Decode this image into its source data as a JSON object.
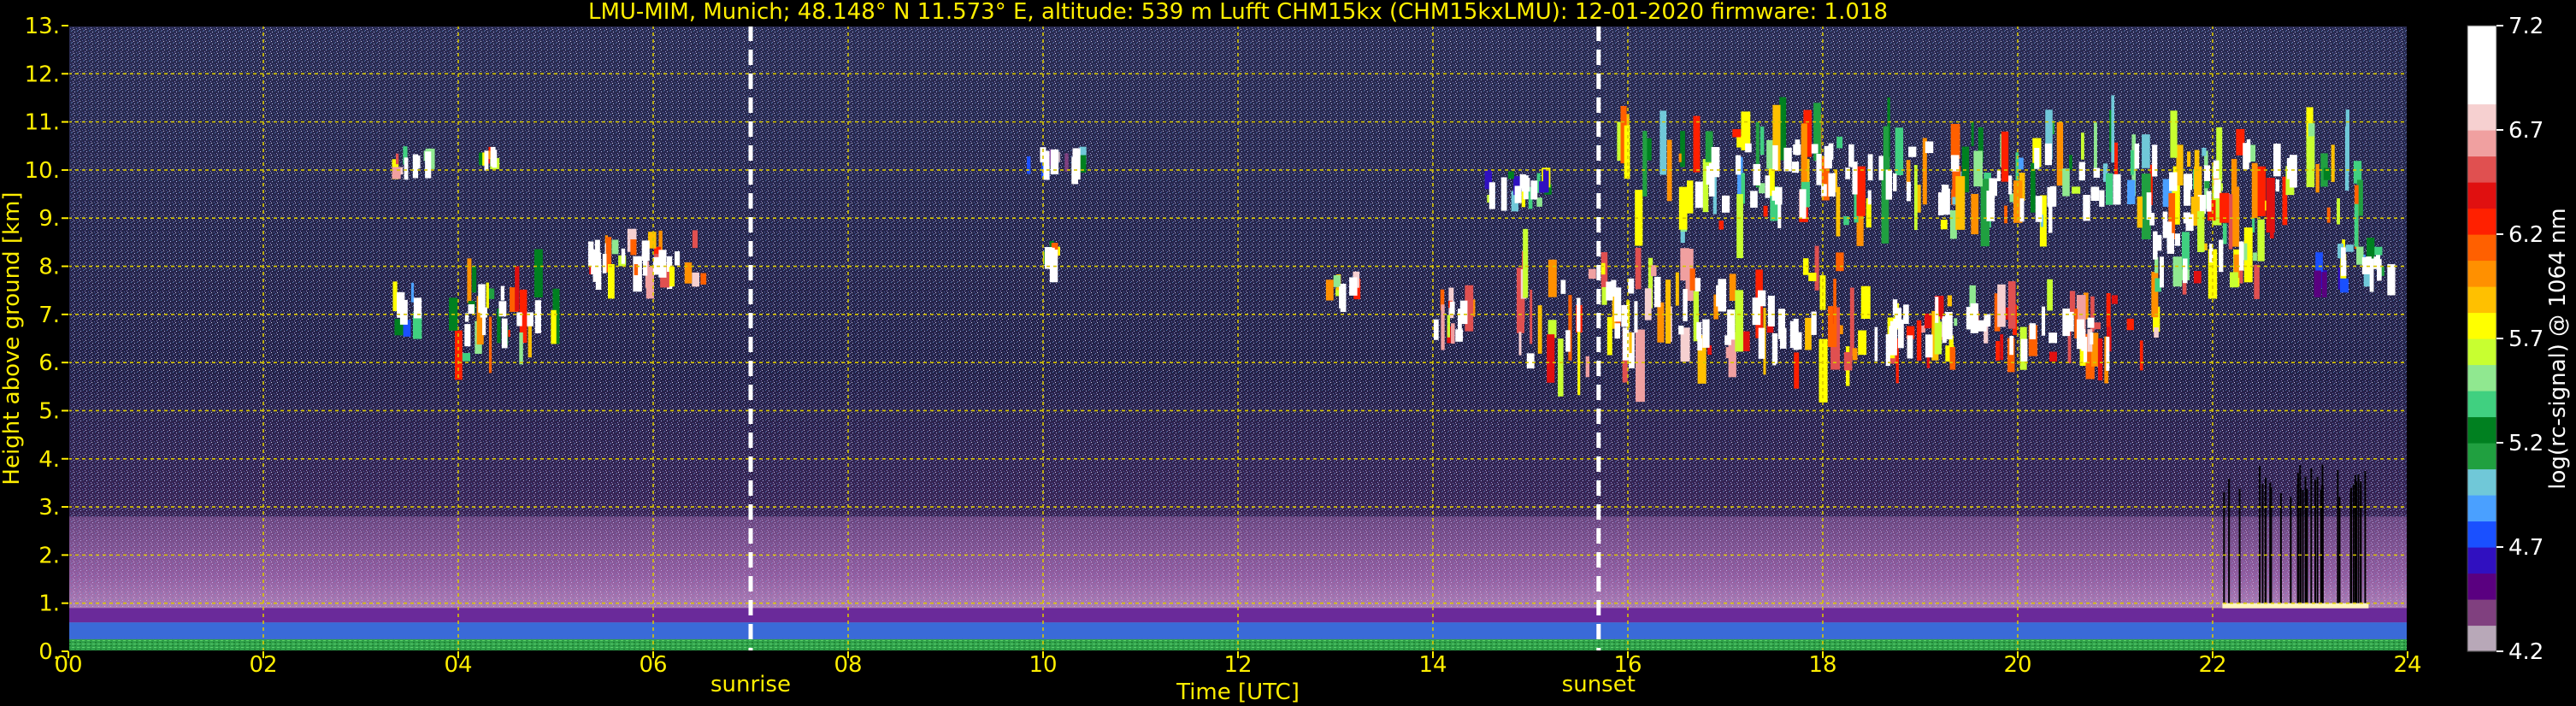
{
  "title": "LMU-MIM, Munich; 48.148° N 11.573° E, altitude: 539 m    Lufft CHM15kx (CHM15kxLMU): 12-01-2020    firmware: 1.018",
  "colors": {
    "background": "#000000",
    "axis_text": "#ffee00",
    "grid": "#d8c600",
    "markers": "#ffffff"
  },
  "chart_data": {
    "type": "heatmap",
    "title": "LMU-MIM, Munich; 48.148° N 11.573° E, altitude: 539 m    Lufft CHM15kx (CHM15kxLMU): 12-01-2020    firmware: 1.018",
    "xlabel": "Time [UTC]",
    "ylabel": "Height above ground [km]",
    "xlim": [
      0,
      24
    ],
    "ylim": [
      0,
      13
    ],
    "xticks": [
      0,
      2,
      4,
      6,
      8,
      10,
      12,
      14,
      16,
      18,
      20,
      22,
      24
    ],
    "xtick_labels": [
      "00",
      "02",
      "04",
      "06",
      "08",
      "10",
      "12",
      "14",
      "16",
      "18",
      "20",
      "22",
      "24"
    ],
    "yticks": [
      0,
      1,
      2,
      3,
      4,
      5,
      6,
      7,
      8,
      9,
      10,
      11,
      12,
      13
    ],
    "ytick_labels": [
      "0.",
      "1.",
      "2.",
      "3.",
      "4.",
      "5.",
      "6.",
      "7.",
      "8.",
      "9.",
      "10.",
      "11.",
      "12.",
      "13."
    ],
    "grid": true,
    "markers": [
      {
        "label": "sunrise",
        "x": 7.0
      },
      {
        "label": "sunset",
        "x": 15.7
      }
    ],
    "colorbar": {
      "label": "log(rc-signal) @ 1064 nm",
      "min": 4.2,
      "max": 7.2,
      "ticks": [
        4.2,
        4.7,
        5.2,
        5.7,
        6.2,
        6.7,
        7.2
      ],
      "tick_labels": [
        "4.2",
        "4.7",
        "5.2",
        "5.7",
        "6.2",
        "6.7",
        "7.2"
      ],
      "colors": [
        "#b8a8b8",
        "#80407f",
        "#5a0080",
        "#3010c0",
        "#1a50ff",
        "#4aa0ff",
        "#70c8d8",
        "#20a040",
        "#008020",
        "#40d080",
        "#90e890",
        "#c8ff30",
        "#ffff00",
        "#ffc000",
        "#ff9000",
        "#ff6000",
        "#ff2000",
        "#e01010",
        "#e05050",
        "#f0a0a0",
        "#f6d0d0",
        "#ffffff",
        "#ffffff",
        "#ffffff"
      ]
    },
    "features": [
      {
        "kind": "boundary_layer",
        "x": [
          0,
          24
        ],
        "y": [
          0,
          0.9
        ],
        "value": 5.4
      },
      {
        "kind": "residual_layer",
        "x": [
          0,
          24
        ],
        "y": [
          0.9,
          2.8
        ],
        "value": 4.6
      },
      {
        "kind": "cloud",
        "x": [
          3.3,
          3.7
        ],
        "y": [
          9.9,
          10.4
        ],
        "value": 6.8
      },
      {
        "kind": "cloud",
        "x": [
          4.2,
          4.4
        ],
        "y": [
          10.1,
          10.4
        ],
        "value": 6.6
      },
      {
        "kind": "cloud",
        "x": [
          3.3,
          3.6
        ],
        "y": [
          6.5,
          7.5
        ],
        "value": 5.8
      },
      {
        "kind": "cloud",
        "x": [
          3.9,
          5.1
        ],
        "y": [
          6.1,
          7.9
        ],
        "value": 6.5
      },
      {
        "kind": "cloud",
        "x": [
          5.2,
          6.5
        ],
        "y": [
          7.6,
          8.6
        ],
        "value": 6.9
      },
      {
        "kind": "cloud",
        "x": [
          9.8,
          10.4
        ],
        "y": [
          10.0,
          10.4
        ],
        "value": 5.4
      },
      {
        "kind": "cloud",
        "x": [
          10.0,
          10.1
        ],
        "y": [
          8.1,
          8.4
        ],
        "value": 6.6
      },
      {
        "kind": "cloud",
        "x": [
          12.9,
          13.2
        ],
        "y": [
          7.3,
          7.8
        ],
        "value": 6.8
      },
      {
        "kind": "cloud",
        "x": [
          13.9,
          14.4
        ],
        "y": [
          6.0,
          7.4
        ],
        "value": 6.8
      },
      {
        "kind": "cloud",
        "x": [
          14.5,
          15.2
        ],
        "y": [
          9.3,
          9.9
        ],
        "value": 5.8
      },
      {
        "kind": "cloud",
        "x": [
          14.8,
          18.3
        ],
        "y": [
          5.8,
          8.1
        ],
        "value": 7.0
      },
      {
        "kind": "cloud",
        "x": [
          15.8,
          23.6
        ],
        "y": [
          8.8,
          10.9
        ],
        "value": 6.3
      },
      {
        "kind": "cloud",
        "x": [
          18.2,
          21.4
        ],
        "y": [
          6.0,
          7.5
        ],
        "value": 6.9
      },
      {
        "kind": "cloud",
        "x": [
          21.2,
          22.6
        ],
        "y": [
          7.6,
          9.3
        ],
        "value": 6.7
      },
      {
        "kind": "cloud",
        "x": [
          23.0,
          23.9
        ],
        "y": [
          7.6,
          8.4
        ],
        "value": 5.9
      },
      {
        "kind": "precip_streaks",
        "x": [
          22.1,
          23.6
        ],
        "y": [
          1.0,
          3.9
        ],
        "value": 4.2
      }
    ]
  }
}
